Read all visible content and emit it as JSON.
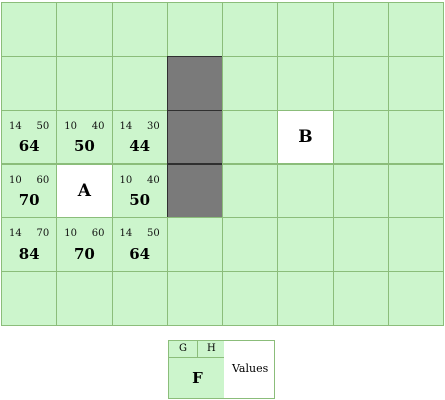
{
  "grid": {
    "rows": 6,
    "cols": 8
  },
  "colors": {
    "open": "#ccf5cc",
    "wall": "#7a7a7a",
    "endpoint": "#ffffff",
    "line": "#8bbd7a"
  },
  "walls": [
    [
      1,
      3
    ],
    [
      2,
      3
    ],
    [
      3,
      3
    ]
  ],
  "endpoints": [
    {
      "row": 3,
      "col": 1,
      "label": "A"
    },
    {
      "row": 2,
      "col": 5,
      "label": "B"
    }
  ],
  "scored": [
    {
      "row": 2,
      "col": 0,
      "g": "14",
      "h": "50",
      "f": "64"
    },
    {
      "row": 2,
      "col": 1,
      "g": "10",
      "h": "40",
      "f": "50"
    },
    {
      "row": 2,
      "col": 2,
      "g": "14",
      "h": "30",
      "f": "44"
    },
    {
      "row": 3,
      "col": 0,
      "g": "10",
      "h": "60",
      "f": "70"
    },
    {
      "row": 3,
      "col": 2,
      "g": "10",
      "h": "40",
      "f": "50"
    },
    {
      "row": 4,
      "col": 0,
      "g": "14",
      "h": "70",
      "f": "84"
    },
    {
      "row": 4,
      "col": 1,
      "g": "10",
      "h": "60",
      "f": "70"
    },
    {
      "row": 4,
      "col": 2,
      "g": "14",
      "h": "50",
      "f": "64"
    }
  ],
  "legend": {
    "g": "G",
    "h": "H",
    "f": "F",
    "values": "Values"
  }
}
